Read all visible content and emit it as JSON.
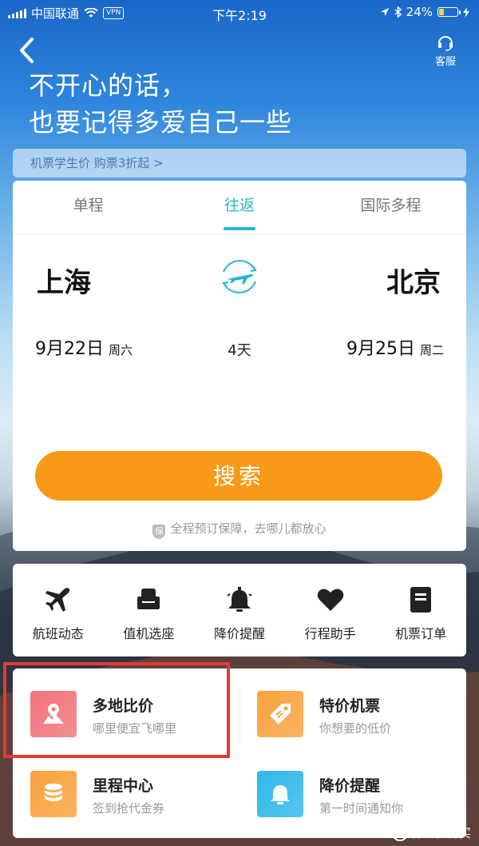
{
  "status_bar": {
    "carrier": "中国联通",
    "vpn": "VPN",
    "time": "下午2:19",
    "battery": "24%",
    "battery_level": 0.24
  },
  "header": {
    "service_label": "客服",
    "headline_line1": "不开心的话，",
    "headline_line2": "也要记得多爱自己一些"
  },
  "promo": {
    "text": "机票学生价 购票3折起 >"
  },
  "search": {
    "tabs": [
      {
        "label": "单程"
      },
      {
        "label": "往返"
      },
      {
        "label": "国际多程"
      }
    ],
    "active_tab": "往返",
    "from_city": "上海",
    "to_city": "北京",
    "depart_date": "9月22日",
    "depart_weekday": "周六",
    "return_date": "9月25日",
    "return_weekday": "周二",
    "duration": "4天",
    "search_label": "搜索",
    "guarantee_icon_text": "保",
    "guarantee_text": "全程预订保障，去哪儿都放心",
    "accent_color": "#25b7d3",
    "button_color": "#f89a17"
  },
  "quick_actions": [
    {
      "label": "航班动态",
      "icon": "airplane-icon"
    },
    {
      "label": "值机选座",
      "icon": "seat-icon"
    },
    {
      "label": "降价提醒",
      "icon": "bell-icon"
    },
    {
      "label": "行程助手",
      "icon": "heart-icon"
    },
    {
      "label": "机票订单",
      "icon": "document-icon"
    }
  ],
  "features": [
    {
      "title": "多地比价",
      "subtitle": "哪里便宜飞哪里",
      "icon": "map-pin-icon",
      "color": "#f2727a"
    },
    {
      "title": "特价机票",
      "subtitle": "你想要的低价",
      "icon": "price-tag-icon",
      "color": "#f9a23c"
    },
    {
      "title": "里程中心",
      "subtitle": "签到抢代金券",
      "icon": "coins-icon",
      "color": "#f9a23c"
    },
    {
      "title": "降价提醒",
      "subtitle": "第一时间通知你",
      "icon": "bell-icon",
      "color": "#2fb7ea"
    }
  ],
  "watermark": {
    "badge": "值",
    "text": "什么值得买"
  }
}
